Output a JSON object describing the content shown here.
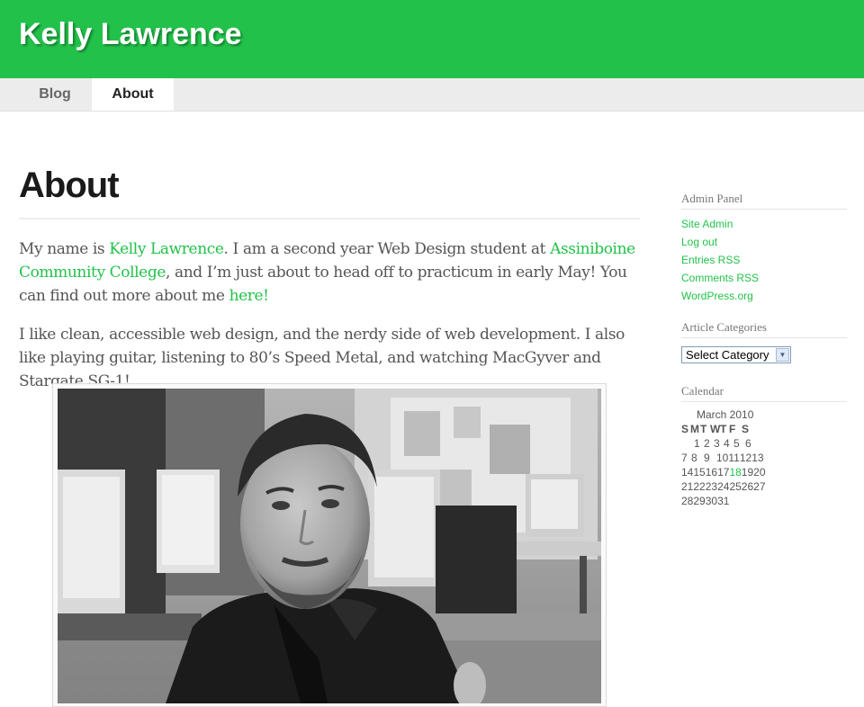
{
  "header": {
    "site_title": "Kelly Lawrence",
    "brand_color": "#22c24a"
  },
  "nav": {
    "tabs": [
      {
        "label": "Blog"
      },
      {
        "label": "About",
        "active": true
      }
    ]
  },
  "main": {
    "title": "About",
    "p1": {
      "t1": "My name is ",
      "link1": "Kelly Lawrence",
      "t2": ". I am a second year Web Design student at ",
      "link2": "Assiniboine Community College",
      "t3": ", and I’m just about to head off to practicum in early May! You can find out more about me ",
      "link3": "here!"
    },
    "p2": "I like clean, accessible web design, and the nerdy side of web development. I also like playing guitar, listening to 80’s Speed Metal, and watching MacGyver and Stargate SG-1!"
  },
  "sidebar": {
    "admin": {
      "title": "Admin Panel",
      "links": [
        "Site Admin",
        "Log out",
        "Entries RSS",
        "Comments RSS",
        "WordPress.org"
      ]
    },
    "categories": {
      "title": "Article Categories",
      "selected": "Select Category"
    },
    "calendar": {
      "title": "Calendar",
      "caption": "March 2010",
      "head": [
        "S",
        "M",
        "T",
        "W",
        "T",
        "F",
        "S"
      ],
      "weeks": [
        [
          "",
          "1",
          "2",
          "3",
          "4",
          "5",
          "6"
        ],
        [
          "7",
          "8",
          "9",
          "10",
          "11",
          "12",
          "13"
        ],
        [
          "14",
          "15",
          "16",
          "17",
          "18",
          "19",
          "20"
        ],
        [
          "21",
          "22",
          "23",
          "24",
          "25",
          "26",
          "27"
        ],
        [
          "28",
          "29",
          "30",
          "31",
          "",
          "",
          ""
        ]
      ],
      "today": "18"
    }
  }
}
